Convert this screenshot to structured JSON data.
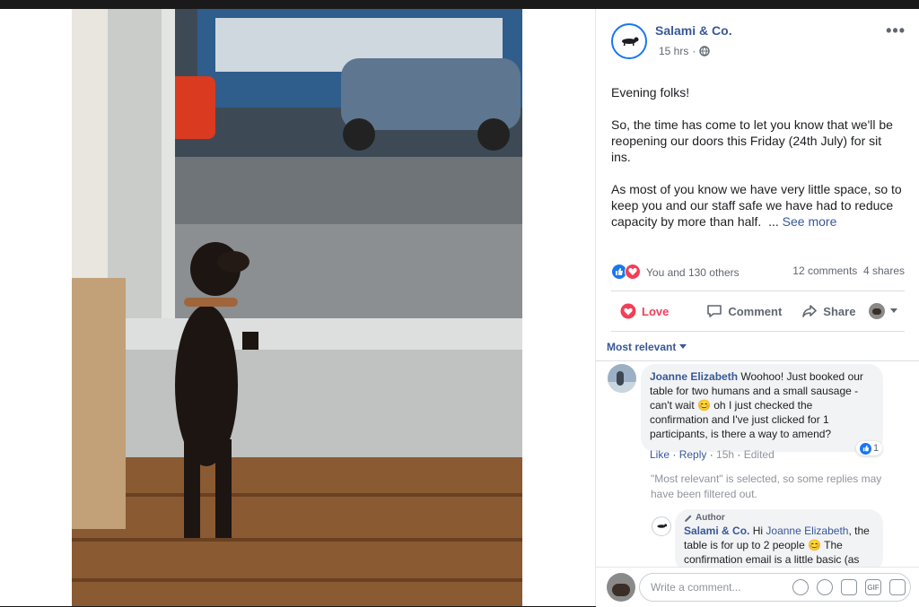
{
  "post": {
    "page_name": "Salami & Co.",
    "time": "15 hrs",
    "dot": "·",
    "more": "•••",
    "text_p1": "Evening folks!",
    "text_p2": "So, the time has come to let you know that we'll be reopening our doors this Friday (24th July) for sit ins.",
    "text_p3": "As most of you know we have very little space, so to keep you and our staff safe we have had to reduce capacity by more than half.",
    "ellipsis": "...",
    "see_more": "See more"
  },
  "reactions": {
    "count_label": "You and 130 others",
    "comments": "12 comments",
    "shares": "4 shares"
  },
  "actions": {
    "love": "Love",
    "comment": "Comment",
    "share": "Share"
  },
  "comments": {
    "sort_label": "Most relevant",
    "first": {
      "author": "Joanne Elizabeth",
      "text": "Woohoo! Just booked our table for two humans and a small sausage - can't wait 😊 oh I just checked the confirmation and I've just clicked for 1 participants, is there a way to amend?",
      "like": "Like",
      "reply": "Reply",
      "time": "15h",
      "edited": "Edited",
      "like_count": "1"
    },
    "filter_note": "\"Most relevant\" is selected, so some replies may have been filtered out.",
    "reply": {
      "badge": "Author",
      "author": "Salami & Co.",
      "text_prefix": "Hi",
      "mention": "Joanne Elizabeth",
      "text": ", the table is for up to 2 people 😊 The confirmation email is a little basic (as"
    }
  },
  "composer": {
    "placeholder": "Write a comment...",
    "gif": "GIF"
  },
  "colors": {
    "link": "#385898",
    "love": "#f33e58",
    "like": "#1877f2"
  }
}
